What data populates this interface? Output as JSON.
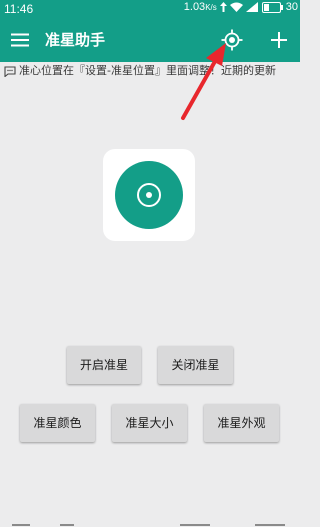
{
  "status_bar": {
    "time": "11:46",
    "network_speed": "1.03",
    "network_unit": "K/s",
    "battery": "30"
  },
  "app_bar": {
    "title": "准星助手",
    "menu_icon": "hamburger-menu-icon",
    "crosshair_icon": "crosshair-icon",
    "add_icon": "add-icon"
  },
  "marquee": {
    "text": "准心位置在『设置-准星位置』里面调整！近期的更新"
  },
  "center_icon": {
    "name": "crosshair-app-icon",
    "color": "#139e88"
  },
  "buttons": {
    "open": "开启准星",
    "close": "关闭准星",
    "color": "准星颜色",
    "size": "准星大小",
    "style": "准星外观"
  },
  "colors": {
    "primary": "#139e88",
    "background": "#ececed",
    "button_bg": "#d9d9da",
    "annotation_arrow": "#e8272d"
  }
}
